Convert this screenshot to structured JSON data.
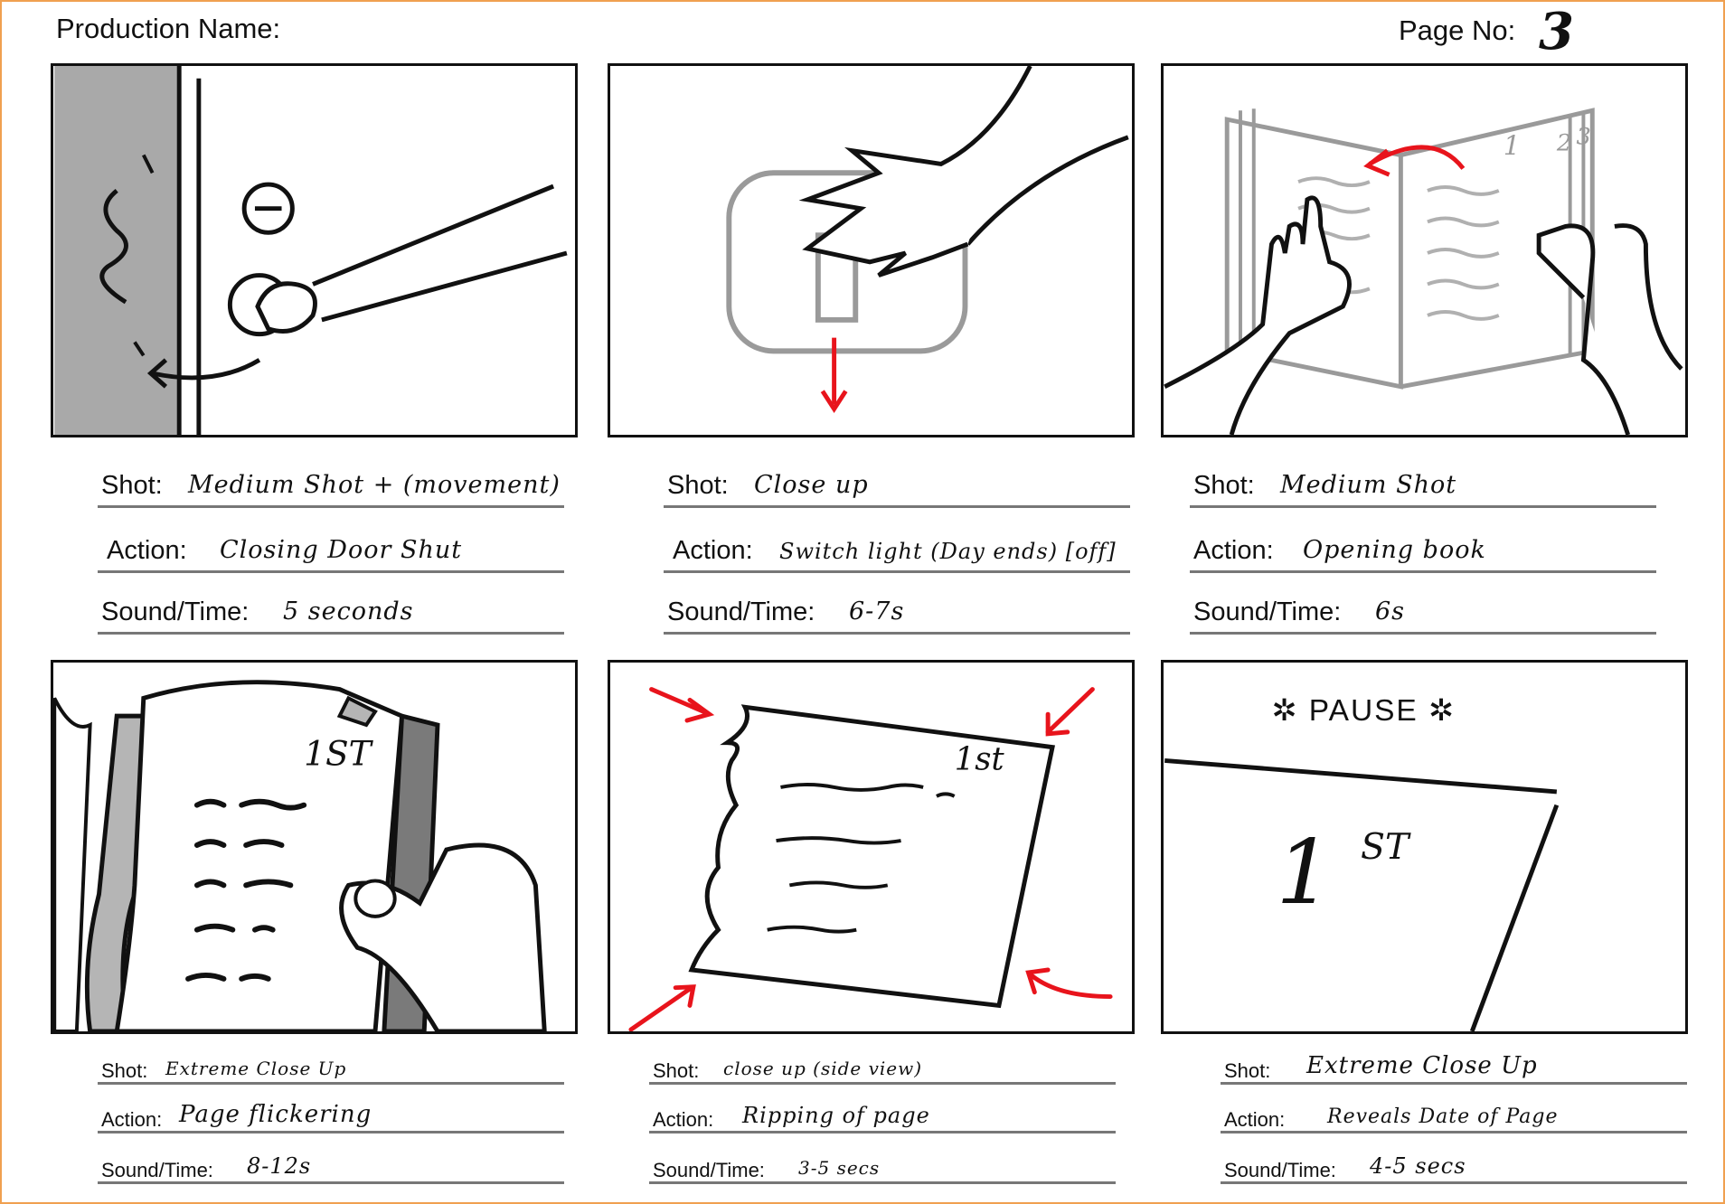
{
  "header": {
    "production_label": "Production Name:",
    "production_value": "",
    "page_label": "Page No:",
    "page_value": "3"
  },
  "panels": [
    {
      "shot_label": "Shot:",
      "shot": "Medium Shot + (movement)",
      "action_label": "Action:",
      "action": "Closing Door Shut",
      "sound_label": "Sound/Time:",
      "sound": "5 seconds"
    },
    {
      "shot_label": "Shot:",
      "shot": "Close up",
      "action_label": "Action:",
      "action": "Switch light (Day ends) [off]",
      "sound_label": "Sound/Time:",
      "sound": "6-7s"
    },
    {
      "shot_label": "Shot:",
      "shot": "Medium Shot",
      "action_label": "Action:",
      "action": "Opening book",
      "sound_label": "Sound/Time:",
      "sound": "6s"
    },
    {
      "shot_label": "Shot:",
      "shot": "Extreme Close Up",
      "action_label": "Action:",
      "action": "Page flickering",
      "sound_label": "Sound/Time:",
      "sound": "8-12s"
    },
    {
      "shot_label": "Shot:",
      "shot": "close up (side view)",
      "action_label": "Action:",
      "action": "Ripping of page",
      "sound_label": "Sound/Time:",
      "sound": "3-5 secs"
    },
    {
      "shot_label": "Shot:",
      "shot": "Extreme Close Up",
      "action_label": "Action:",
      "action": "Reveals Date of Page",
      "sound_label": "Sound/Time:",
      "sound": "4-5 secs"
    }
  ],
  "drawings": {
    "book_page_numbers": [
      "1",
      "2",
      "3"
    ],
    "page_ordinal": "1st",
    "page_ordinal_alt": "1ST",
    "pause_text": "✲ PAUSE ✲",
    "big_ordinal_number": "1",
    "big_ordinal_suffix": "ST"
  },
  "colors": {
    "border": "#f0a050",
    "arrow_red": "#e8141c",
    "door_grey": "#a9a9a9",
    "sketch_grey": "#9a9a9a"
  }
}
